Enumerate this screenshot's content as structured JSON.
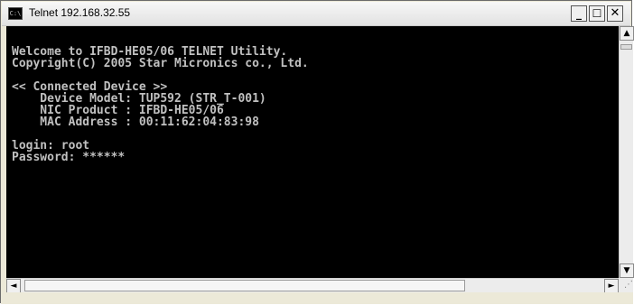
{
  "window": {
    "title": "Telnet 192.168.32.55",
    "icon": "console-icon",
    "icon_text": "C:\\",
    "controls": {
      "minimize": "_",
      "maximize": "☐",
      "close": "✕"
    }
  },
  "terminal": {
    "lines": [
      "Welcome to IFBD-HE05/06 TELNET Utility.",
      "Copyright(C) 2005 Star Micronics co., Ltd.",
      "",
      "<< Connected Device >>",
      "    Device Model: TUP592 (STR_T-001)",
      "    NIC Product : IFBD-HE05/06",
      "    MAC Address : 00:11:62:04:83:98",
      "",
      "login: root",
      "Password: ******"
    ],
    "foreground": "#c0c0c0",
    "background": "#000000"
  },
  "scrollbars": {
    "up": "▲",
    "down": "▼",
    "left": "◄",
    "right": "►"
  }
}
